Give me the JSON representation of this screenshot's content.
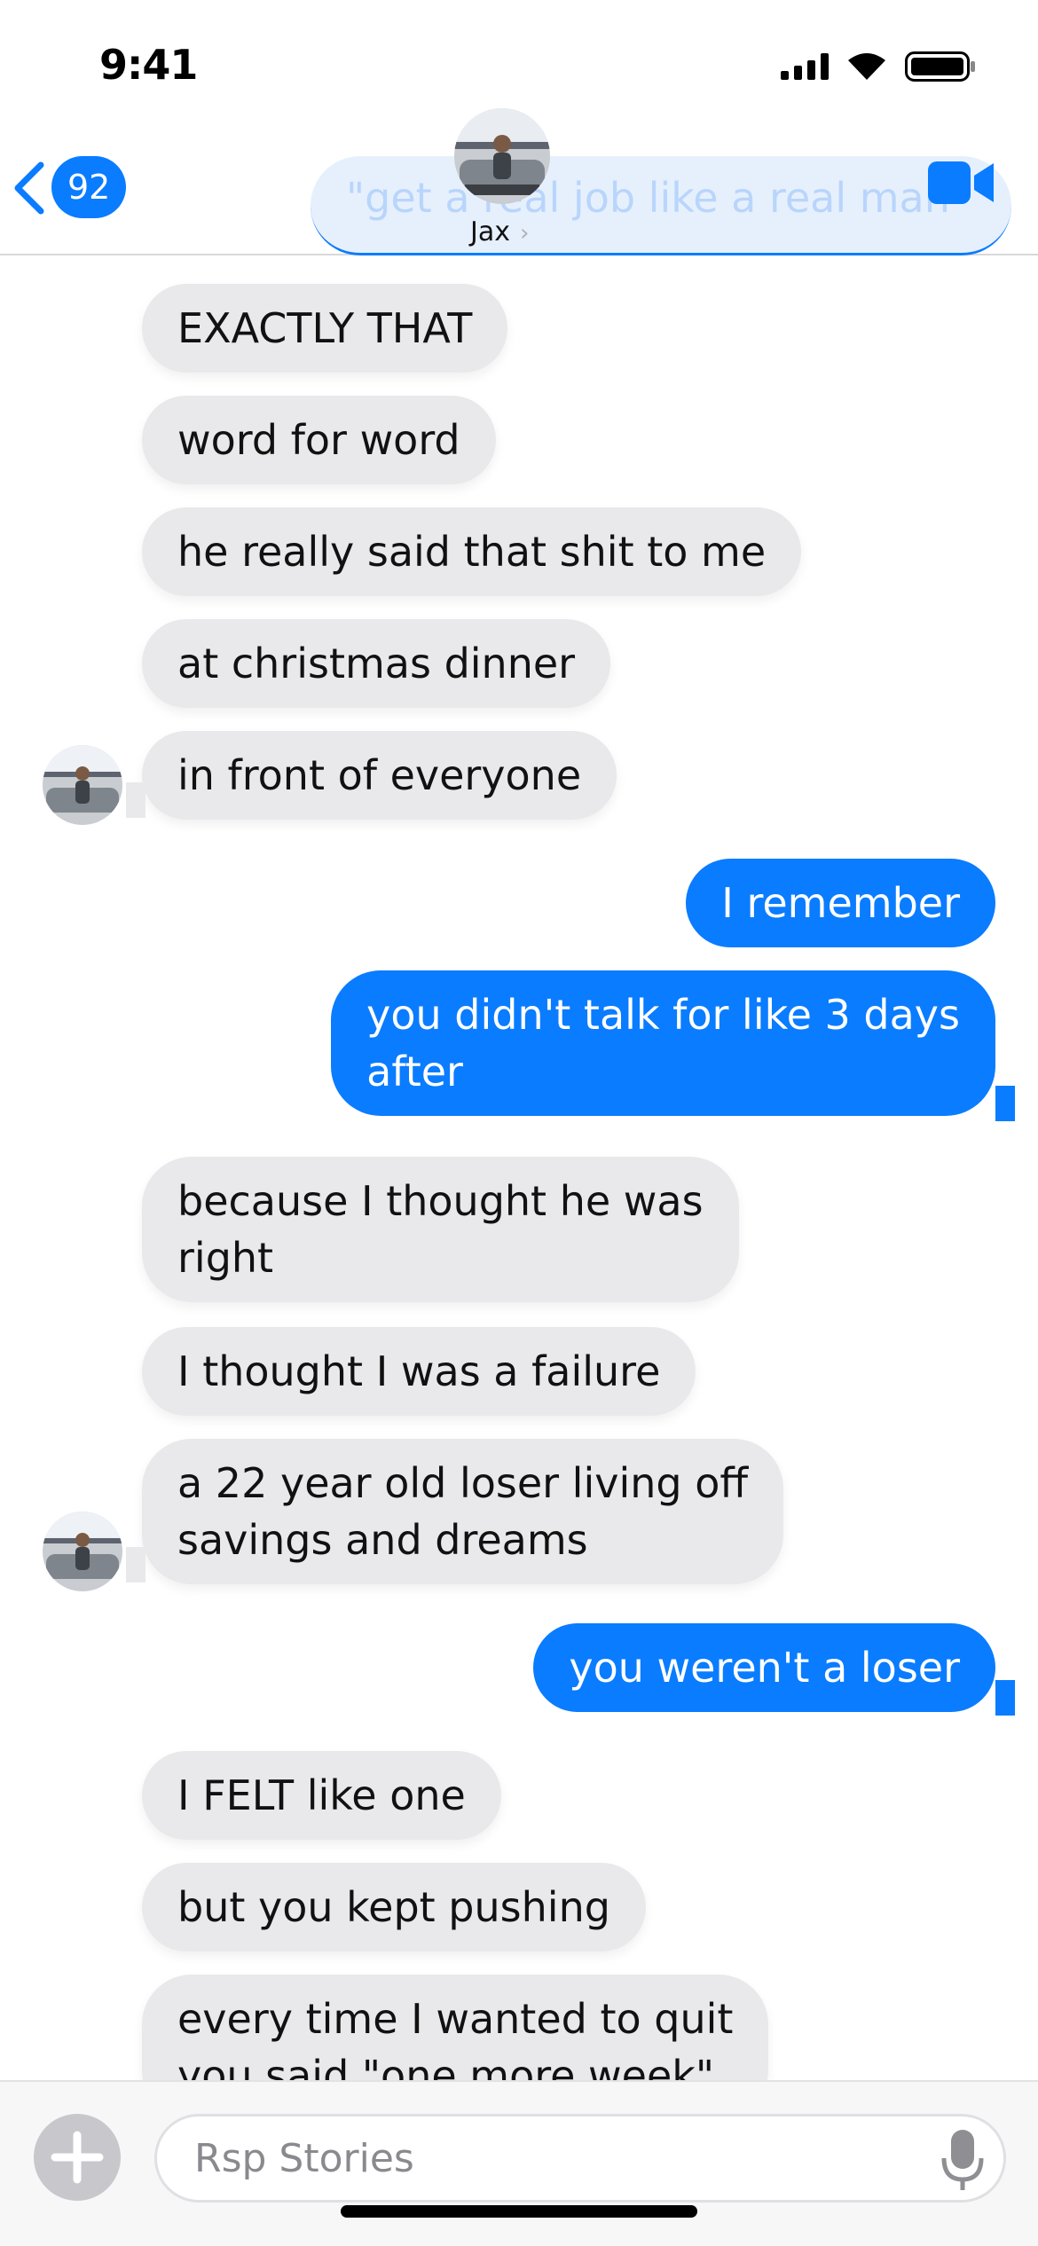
{
  "status_bar": {
    "time": "9:41"
  },
  "header": {
    "back_count": "92",
    "contact_name": "Jax",
    "overlapping_message": "\"get a real job like a real man\""
  },
  "messages": [
    {
      "from": "them",
      "text": "EXACTLY THAT"
    },
    {
      "from": "them",
      "text": "word for word"
    },
    {
      "from": "them",
      "text": "he really said that shit to me"
    },
    {
      "from": "them",
      "text": "at christmas dinner"
    },
    {
      "from": "them",
      "text": "in front of everyone"
    },
    {
      "from": "me",
      "text": "I remember"
    },
    {
      "from": "me",
      "line1": "you didn't talk for like 3 days",
      "line2": "after"
    },
    {
      "from": "them",
      "line1": "because I thought he was",
      "line2": "right"
    },
    {
      "from": "them",
      "text": "I thought I was a failure"
    },
    {
      "from": "them",
      "line1": "a 22 year old loser living off",
      "line2": "savings and dreams"
    },
    {
      "from": "me",
      "text": "you weren't a loser"
    },
    {
      "from": "them",
      "text": "I FELT like one"
    },
    {
      "from": "them",
      "text": "but you kept pushing"
    },
    {
      "from": "them",
      "line1": "every time I wanted to quit",
      "line2": "you said \"one more week\""
    }
  ],
  "compose": {
    "placeholder": "Rsp Stories"
  },
  "colors": {
    "accent": "#0a7cff",
    "incoming_bubble": "#e9e9eb"
  }
}
